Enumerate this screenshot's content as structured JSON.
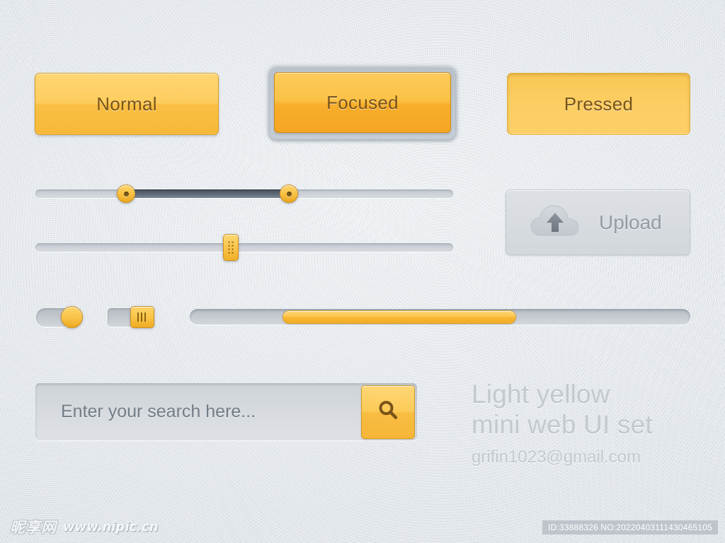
{
  "buttons": {
    "normal_label": "Normal",
    "focused_label": "Focused",
    "pressed_label": "Pressed"
  },
  "upload": {
    "label": "Upload",
    "icon": "cloud-upload-icon"
  },
  "search": {
    "placeholder": "Enter your search here...",
    "value": "",
    "button_icon": "search-icon"
  },
  "sliders": {
    "range": {
      "min_handle_icon": "circle-knob-icon",
      "max_handle_icon": "circle-knob-icon",
      "fill_start_percent": 22,
      "fill_end_percent": 61
    },
    "single": {
      "handle_icon": "grip-dots-knob-icon",
      "value_percent": 46
    }
  },
  "toggles": {
    "round": {
      "state": "on",
      "knob_icon": "round-knob-icon"
    },
    "square": {
      "state": "on",
      "knob_icon": "grip-lines-knob-icon"
    }
  },
  "progress": {
    "value_percent": 47,
    "start_percent": 18
  },
  "brand": {
    "line1": "Light yellow",
    "line2": "mini web UI set",
    "email": "grifin1023@gmail.com"
  },
  "footer": {
    "watermark_logo": "昵享网",
    "watermark_url": "www.nipic.cn",
    "asset_id": "ID:33888326 NO:20220403111430465105"
  },
  "colors": {
    "accent": "#f9c246",
    "accent_dark": "#d79b24",
    "text_on_accent": "#7a5418",
    "background": "#e4e8ec",
    "muted_text": "#c3c9cf"
  }
}
